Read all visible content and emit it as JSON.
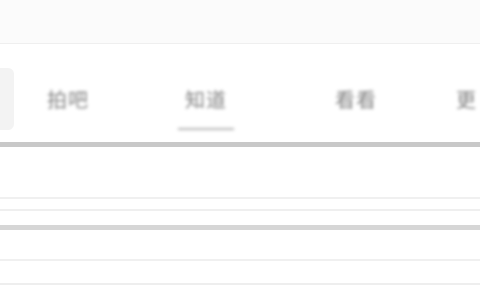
{
  "tabs": [
    {
      "label": "拍吧"
    },
    {
      "label": "知道"
    },
    {
      "label": "看看"
    },
    {
      "label": "更"
    }
  ]
}
